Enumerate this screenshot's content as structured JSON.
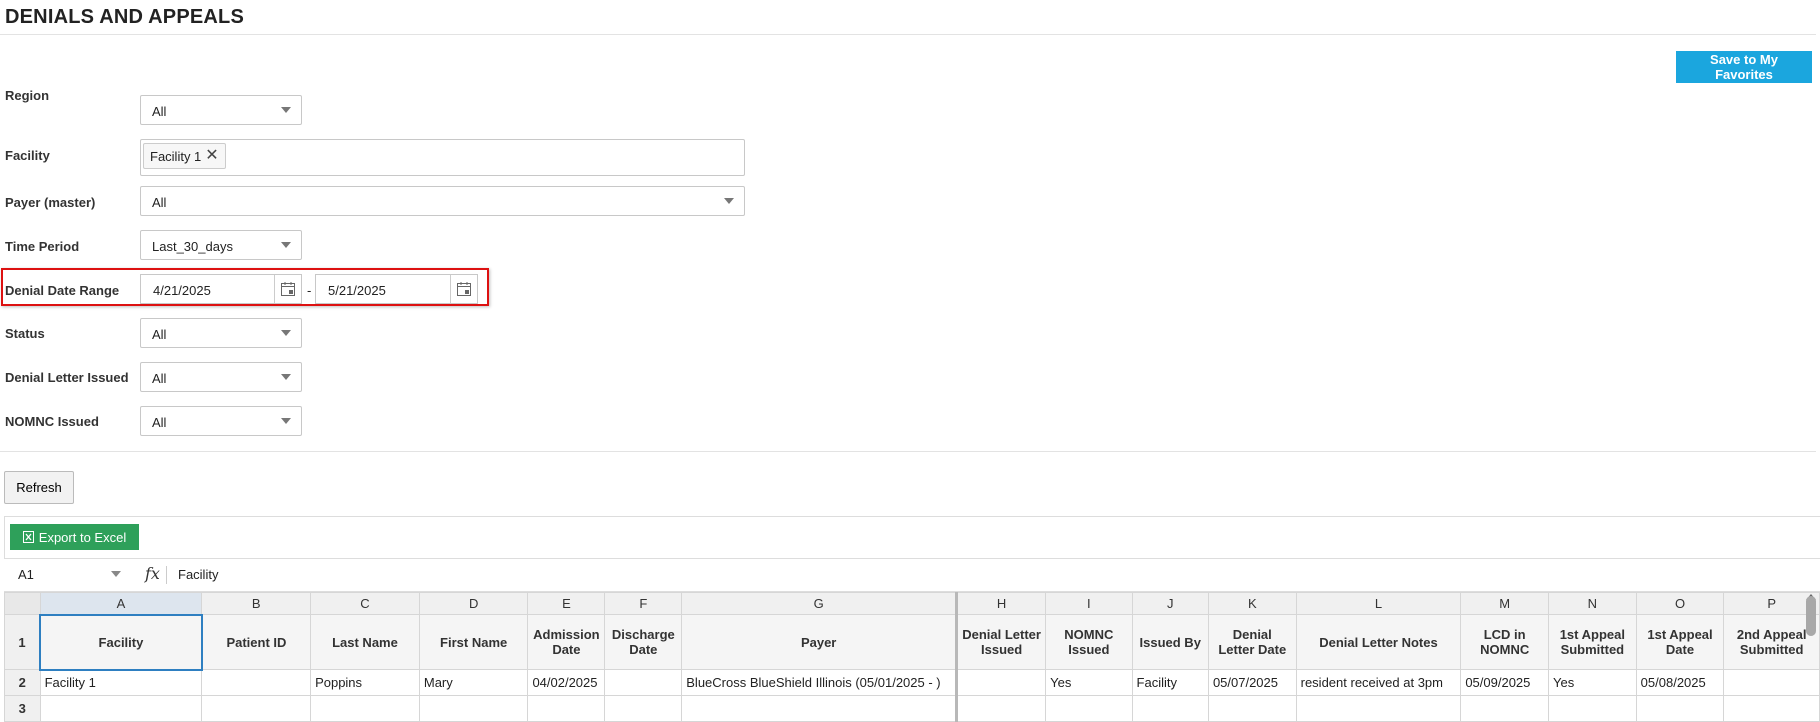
{
  "page": {
    "title": "DENIALS AND APPEALS"
  },
  "actions": {
    "save_favorites": "Save to My Favorites",
    "refresh": "Refresh",
    "export": "Export to Excel"
  },
  "filters": {
    "region": {
      "label": "Region",
      "value": "All"
    },
    "facility": {
      "label": "Facility",
      "tag": "Facility 1"
    },
    "payer": {
      "label": "Payer (master)",
      "value": "All"
    },
    "time_period": {
      "label": "Time Period",
      "value": "Last_30_days"
    },
    "denial_range": {
      "label": "Denial Date Range",
      "from": "4/21/2025",
      "separator": "-",
      "to": "5/21/2025"
    },
    "status": {
      "label": "Status",
      "value": "All"
    },
    "denial_letter": {
      "label": "Denial Letter Issued",
      "value": "All"
    },
    "nomnc": {
      "label": "NOMNC Issued",
      "value": "All"
    }
  },
  "formula_bar": {
    "cell_ref": "A1",
    "fx": "fx",
    "value": "Facility"
  },
  "sheet": {
    "col_letters": [
      "A",
      "B",
      "C",
      "D",
      "E",
      "F",
      "G",
      "H",
      "I",
      "J",
      "K",
      "L",
      "M",
      "N",
      "O",
      "P"
    ],
    "headers": [
      "Facility",
      "Patient ID",
      "Last Name",
      "First Name",
      "Admission Date",
      "Discharge Date",
      "Payer",
      "Denial Letter Issued",
      "NOMNC Issued",
      "Issued By",
      "Denial Letter Date",
      "Denial Letter Notes",
      "LCD in NOMNC",
      "1st Appeal Submitted",
      "1st Appeal Date",
      "2nd Appeal Submitted"
    ],
    "row_numbers": [
      "1",
      "2",
      "3"
    ],
    "rows": [
      [
        "Facility 1",
        "",
        "Poppins",
        "Mary",
        "04/02/2025",
        "",
        "BlueCross BlueShield Illinois (05/01/2025 - )",
        "",
        "Yes",
        "Facility",
        "05/07/2025",
        "resident received at 3pm",
        "05/09/2025",
        "Yes",
        "05/08/2025",
        ""
      ],
      [
        "",
        "",
        "",
        "",
        "",
        "",
        "",
        "",
        "",
        "",
        "",
        "",
        "",
        "",
        "",
        ""
      ]
    ]
  }
}
